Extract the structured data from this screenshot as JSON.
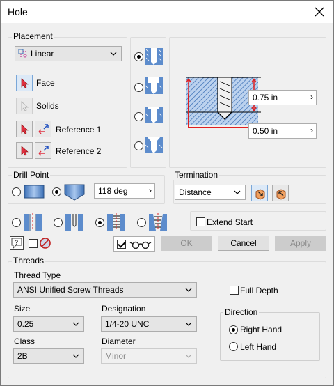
{
  "window": {
    "title": "Hole"
  },
  "placement": {
    "label": "Placement",
    "type_value": "Linear",
    "face_label": "Face",
    "solids_label": "Solids",
    "reference1_label": "Reference 1",
    "reference2_label": "Reference 2"
  },
  "diagram": {
    "depth_value": "0.75 in",
    "distance_value": "0.50 in"
  },
  "drill_point": {
    "label": "Drill Point",
    "angle_value": "118 deg"
  },
  "termination": {
    "label": "Termination",
    "value": "Distance"
  },
  "extend_start": {
    "label": "Extend Start",
    "checked": false
  },
  "buttons": {
    "ok": "OK",
    "cancel": "Cancel",
    "apply": "Apply"
  },
  "threads": {
    "label": "Threads",
    "thread_type_label": "Thread Type",
    "thread_type_value": "ANSI Unified Screw Threads",
    "full_depth_label": "Full Depth",
    "size_label": "Size",
    "size_value": "0.25",
    "designation_label": "Designation",
    "designation_value": "1/4-20 UNC",
    "class_label": "Class",
    "class_value": "2B",
    "diameter_label": "Diameter",
    "diameter_value": "Minor",
    "direction_label": "Direction",
    "right_hand_label": "Right Hand",
    "left_hand_label": "Left Hand",
    "direction_selected": "Right Hand"
  },
  "colors": {
    "accent": "#e02020",
    "selection": "#dce9f7",
    "hatch": "#3a6fb5"
  }
}
